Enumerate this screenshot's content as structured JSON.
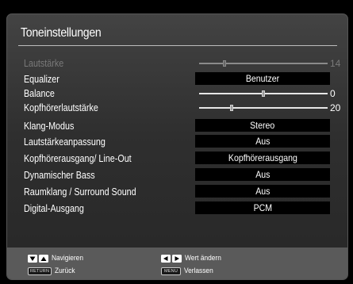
{
  "title": "Toneinstellungen",
  "rows": [
    {
      "label": "Lautstärke",
      "type": "slider",
      "value": "14",
      "level": 0.2,
      "disabled": true
    },
    {
      "label": "Equalizer",
      "type": "option",
      "value": "Benutzer"
    },
    {
      "label": "Balance",
      "type": "slider",
      "value": "0",
      "level": 0.5
    },
    {
      "label": "Kopfhörerlautstärke",
      "type": "slider",
      "value": "20",
      "level": 0.25
    },
    {
      "label": "Klang-Modus",
      "type": "option",
      "value": "Stereo"
    },
    {
      "label": "Lautstärkeanpassung",
      "type": "option",
      "value": "Aus"
    },
    {
      "label": "Kopfhörerausgang/ Line-Out",
      "type": "option",
      "value": "Kopfhörerausgang"
    },
    {
      "label": "Dynamischer Bass",
      "type": "option",
      "value": "Aus"
    },
    {
      "label": "Raumklang / Surround Sound",
      "type": "option",
      "value": "Aus"
    },
    {
      "label": "Digital-Ausgang",
      "type": "option",
      "value": "PCM"
    }
  ],
  "footer": {
    "navigate": {
      "key_label": "",
      "label": "Navigieren"
    },
    "back": {
      "key_label": "RETURN",
      "label": "Zurück"
    },
    "change": {
      "key_label": "",
      "label": "Wert ändern"
    },
    "exit": {
      "key_label": "MENU",
      "label": "Verlassen"
    }
  },
  "colors": {
    "panel": "#3a3a3a",
    "footer": "#5a5a5a",
    "value_box": "#000000",
    "text": "#ffffff",
    "disabled_text": "#7a7a7a"
  }
}
